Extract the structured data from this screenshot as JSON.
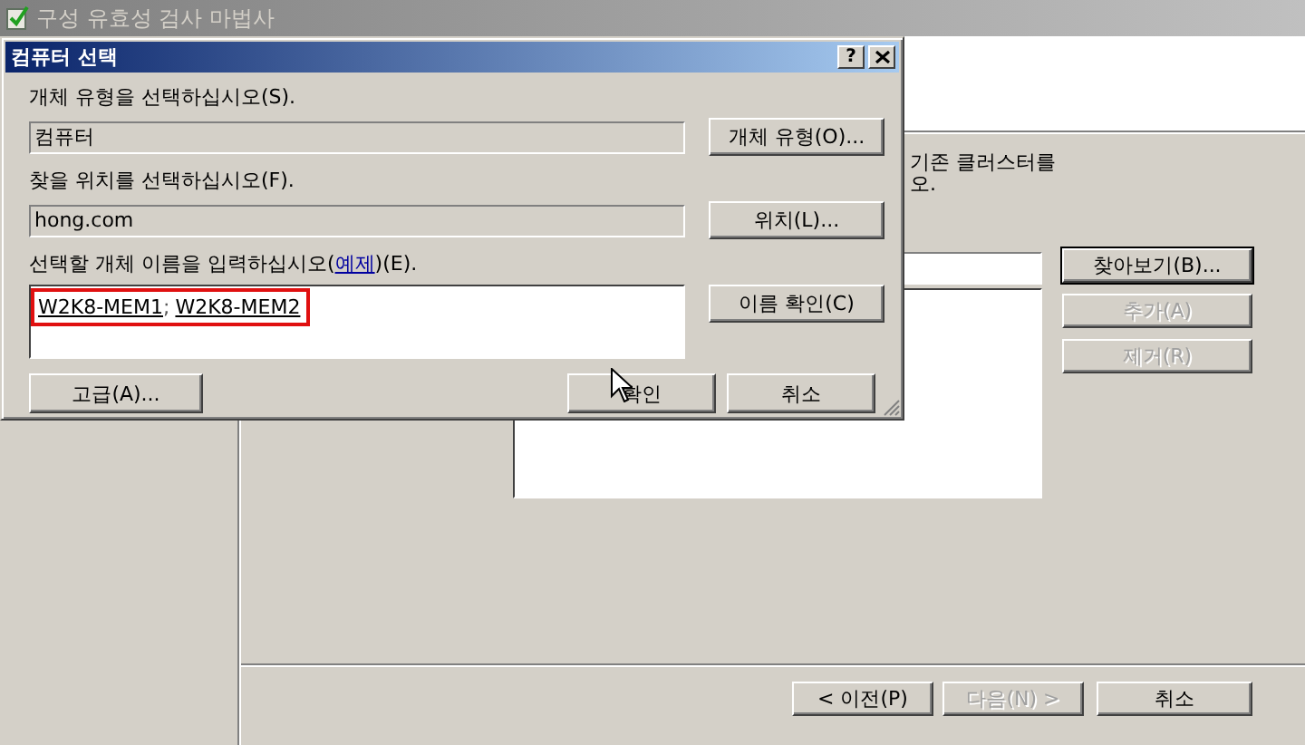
{
  "wizard": {
    "title": "구성 유효성 검사 마법사",
    "instruction_lines": [
      "기존 클러스터를",
      "오."
    ],
    "side_buttons": [
      {
        "label": "찾아보기(B)...",
        "disabled": false,
        "default": true
      },
      {
        "label": "추가(A)",
        "disabled": true,
        "default": false
      },
      {
        "label": "제거(R)",
        "disabled": true,
        "default": false
      }
    ],
    "nav_buttons": [
      {
        "label": "< 이전(P)",
        "disabled": false
      },
      {
        "label": "다음(N) >",
        "disabled": true
      },
      {
        "label": "취소",
        "disabled": false
      }
    ]
  },
  "dialog": {
    "title": "컴퓨터 선택",
    "help_button": "?",
    "object_type": {
      "label": "개체 유형을 선택하십시오(S).",
      "value": "컴퓨터",
      "button": "개체 유형(O)..."
    },
    "location": {
      "label": "찾을 위치를 선택하십시오(F).",
      "value": "hong.com",
      "button": "위치(L)..."
    },
    "names": {
      "label_before": "선택할 개체 이름을 입력하십시오(",
      "link": "예제",
      "label_after": ")(E).",
      "entries": [
        "W2K8-MEM1",
        "W2K8-MEM2"
      ],
      "separator": ";",
      "highlighted": true,
      "button": "이름 확인(C)"
    },
    "buttons": [
      {
        "label": "고급(A)..."
      },
      {
        "label": "확인"
      },
      {
        "label": "취소"
      }
    ]
  }
}
